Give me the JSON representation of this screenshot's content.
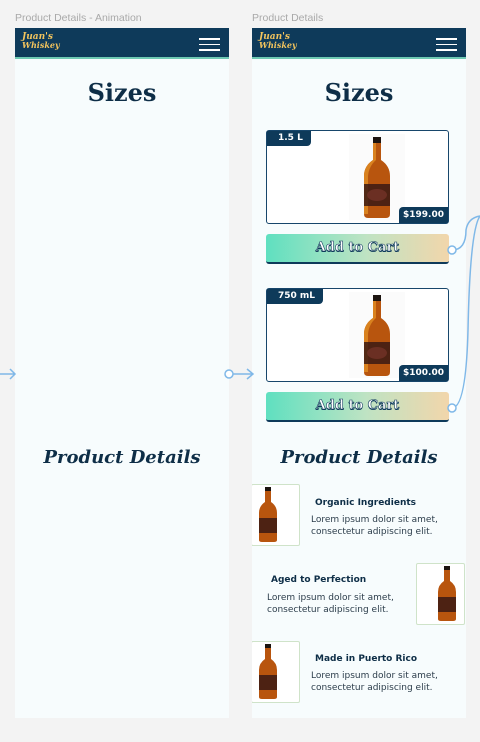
{
  "frames": [
    {
      "label": "Product Details - Animation",
      "logo_line1": "Juan's",
      "logo_line2": "Whiskey",
      "sizes_heading": "Sizes",
      "details_heading": "Product Details"
    },
    {
      "label": "Product Details",
      "logo_line1": "Juan's",
      "logo_line2": "Whiskey",
      "sizes_heading": "Sizes",
      "details_heading": "Product Details",
      "products": [
        {
          "size": "1.5 L",
          "price": "$199.00",
          "button": "Add to Cart"
        },
        {
          "size": "750 mL",
          "price": "$100.00",
          "button": "Add to Cart"
        }
      ],
      "features": [
        {
          "title": "Organic Ingredients",
          "desc": "Lorem ipsum dolor sit amet, consectetur adipiscing elit."
        },
        {
          "title": "Aged to Perfection",
          "desc": "Lorem ipsum dolor sit amet, consectetur adipiscing elit."
        },
        {
          "title": "Made in Puerto Rico",
          "desc": "Lorem ipsum dolor sit amet, consectetur adipiscing elit."
        }
      ]
    }
  ],
  "colors": {
    "navy": "#0e3a5a",
    "accent_teal": "#6ec9b3",
    "logo_gold": "#f3c45d",
    "connector_blue": "#7fb8e8"
  },
  "icons": [
    "menu-icon",
    "whiskey-bottle-icon",
    "arrow-right-icon",
    "connector-curve-icon"
  ]
}
